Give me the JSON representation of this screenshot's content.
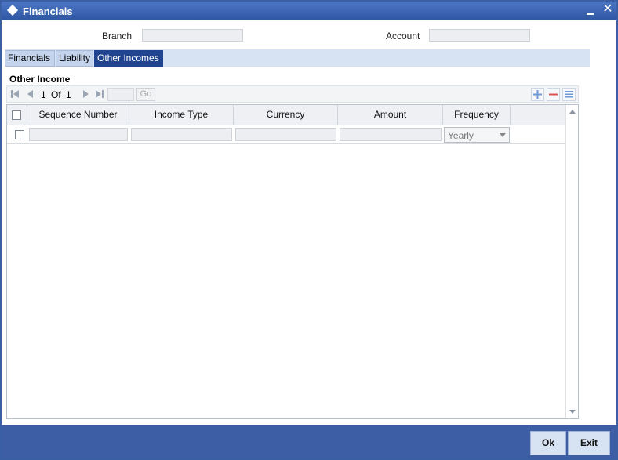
{
  "window": {
    "title": "Financials"
  },
  "header": {
    "branch_label": "Branch",
    "branch_value": "",
    "account_label": "Account",
    "account_value": ""
  },
  "tabs": [
    {
      "label": "Financials",
      "active": false
    },
    {
      "label": "Liability",
      "active": false
    },
    {
      "label": "Other Incomes",
      "active": true
    }
  ],
  "section": {
    "title": "Other Income"
  },
  "pager": {
    "current": "1",
    "of_label": "Of",
    "total": "1",
    "go_label": "Go",
    "page_input": ""
  },
  "grid": {
    "columns": [
      "Sequence Number",
      "Income Type",
      "Currency",
      "Amount",
      "Frequency"
    ],
    "rows": [
      {
        "sequence_number": "",
        "income_type": "",
        "currency": "",
        "amount": "",
        "frequency": "Yearly"
      }
    ]
  },
  "footer": {
    "ok_label": "Ok",
    "exit_label": "Exit"
  },
  "colors": {
    "titlebar": "#2f56a3",
    "active_tab": "#20448f",
    "footer": "#3d5ea5",
    "button_face": "#d7e2f3"
  }
}
